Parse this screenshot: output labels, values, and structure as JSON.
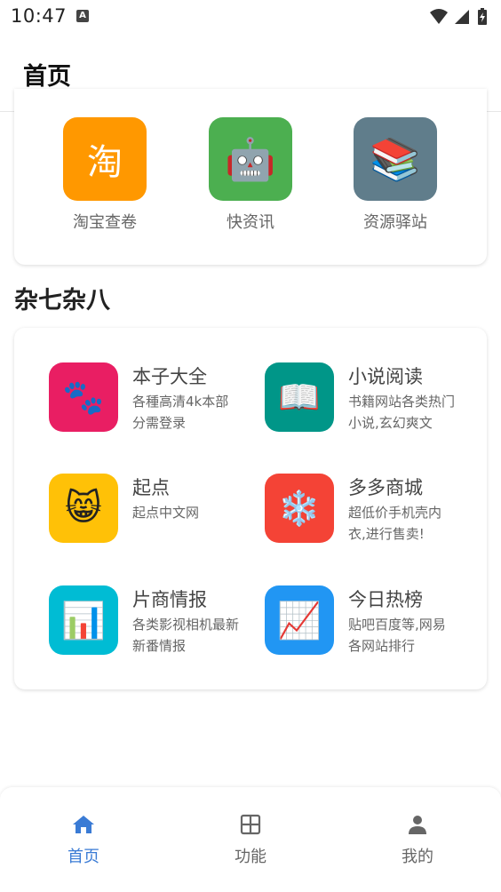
{
  "status_bar": {
    "time": "10:47",
    "a_badge": "A"
  },
  "app_bar": {
    "title": "首页"
  },
  "top_tiles": [
    {
      "label": "淘宝查卷",
      "glyph": "淘",
      "icon": "taobao-icon",
      "color": "#FF9800"
    },
    {
      "label": "快资讯",
      "glyph": "🤖",
      "icon": "robot-icon",
      "color": "#4CAF50"
    },
    {
      "label": "资源驿站",
      "glyph": "📚",
      "icon": "books-icon",
      "color": "#607D8B"
    }
  ],
  "section": {
    "title": "杂七杂八"
  },
  "items": [
    {
      "title": "本子大全",
      "desc": "各種高清4k本部分需登录",
      "glyph": "🐾",
      "icon": "paw-icon",
      "color": "#E91E63"
    },
    {
      "title": "小说阅读",
      "desc": "书籍网站各类热门小说,玄幻爽文",
      "glyph": "📖",
      "icon": "open-book-icon",
      "color": "#009688"
    },
    {
      "title": "起点",
      "desc": "起点中文网",
      "glyph": "😸",
      "icon": "cat-icon",
      "color": "#FFC107"
    },
    {
      "title": "多多商城",
      "desc": "超低价手机壳内衣,进行售卖!",
      "glyph": "❄️",
      "icon": "snowflake-icon",
      "color": "#F44336"
    },
    {
      "title": "片商情报",
      "desc": "各类影视相机最新新番情报",
      "glyph": "📊",
      "icon": "bar-chart-icon",
      "color": "#00BCD4"
    },
    {
      "title": "今日热榜",
      "desc": "贴吧百度等,网易各网站排行",
      "glyph": "📈",
      "icon": "trend-chart-icon",
      "color": "#2196F3"
    }
  ],
  "bottom_nav": {
    "active_color": "#3A7BD5",
    "inactive_color": "#666666",
    "items": [
      {
        "label": "首页",
        "icon": "home-icon",
        "active": true
      },
      {
        "label": "功能",
        "icon": "grid-icon",
        "active": false
      },
      {
        "label": "我的",
        "icon": "person-icon",
        "active": false
      }
    ]
  }
}
